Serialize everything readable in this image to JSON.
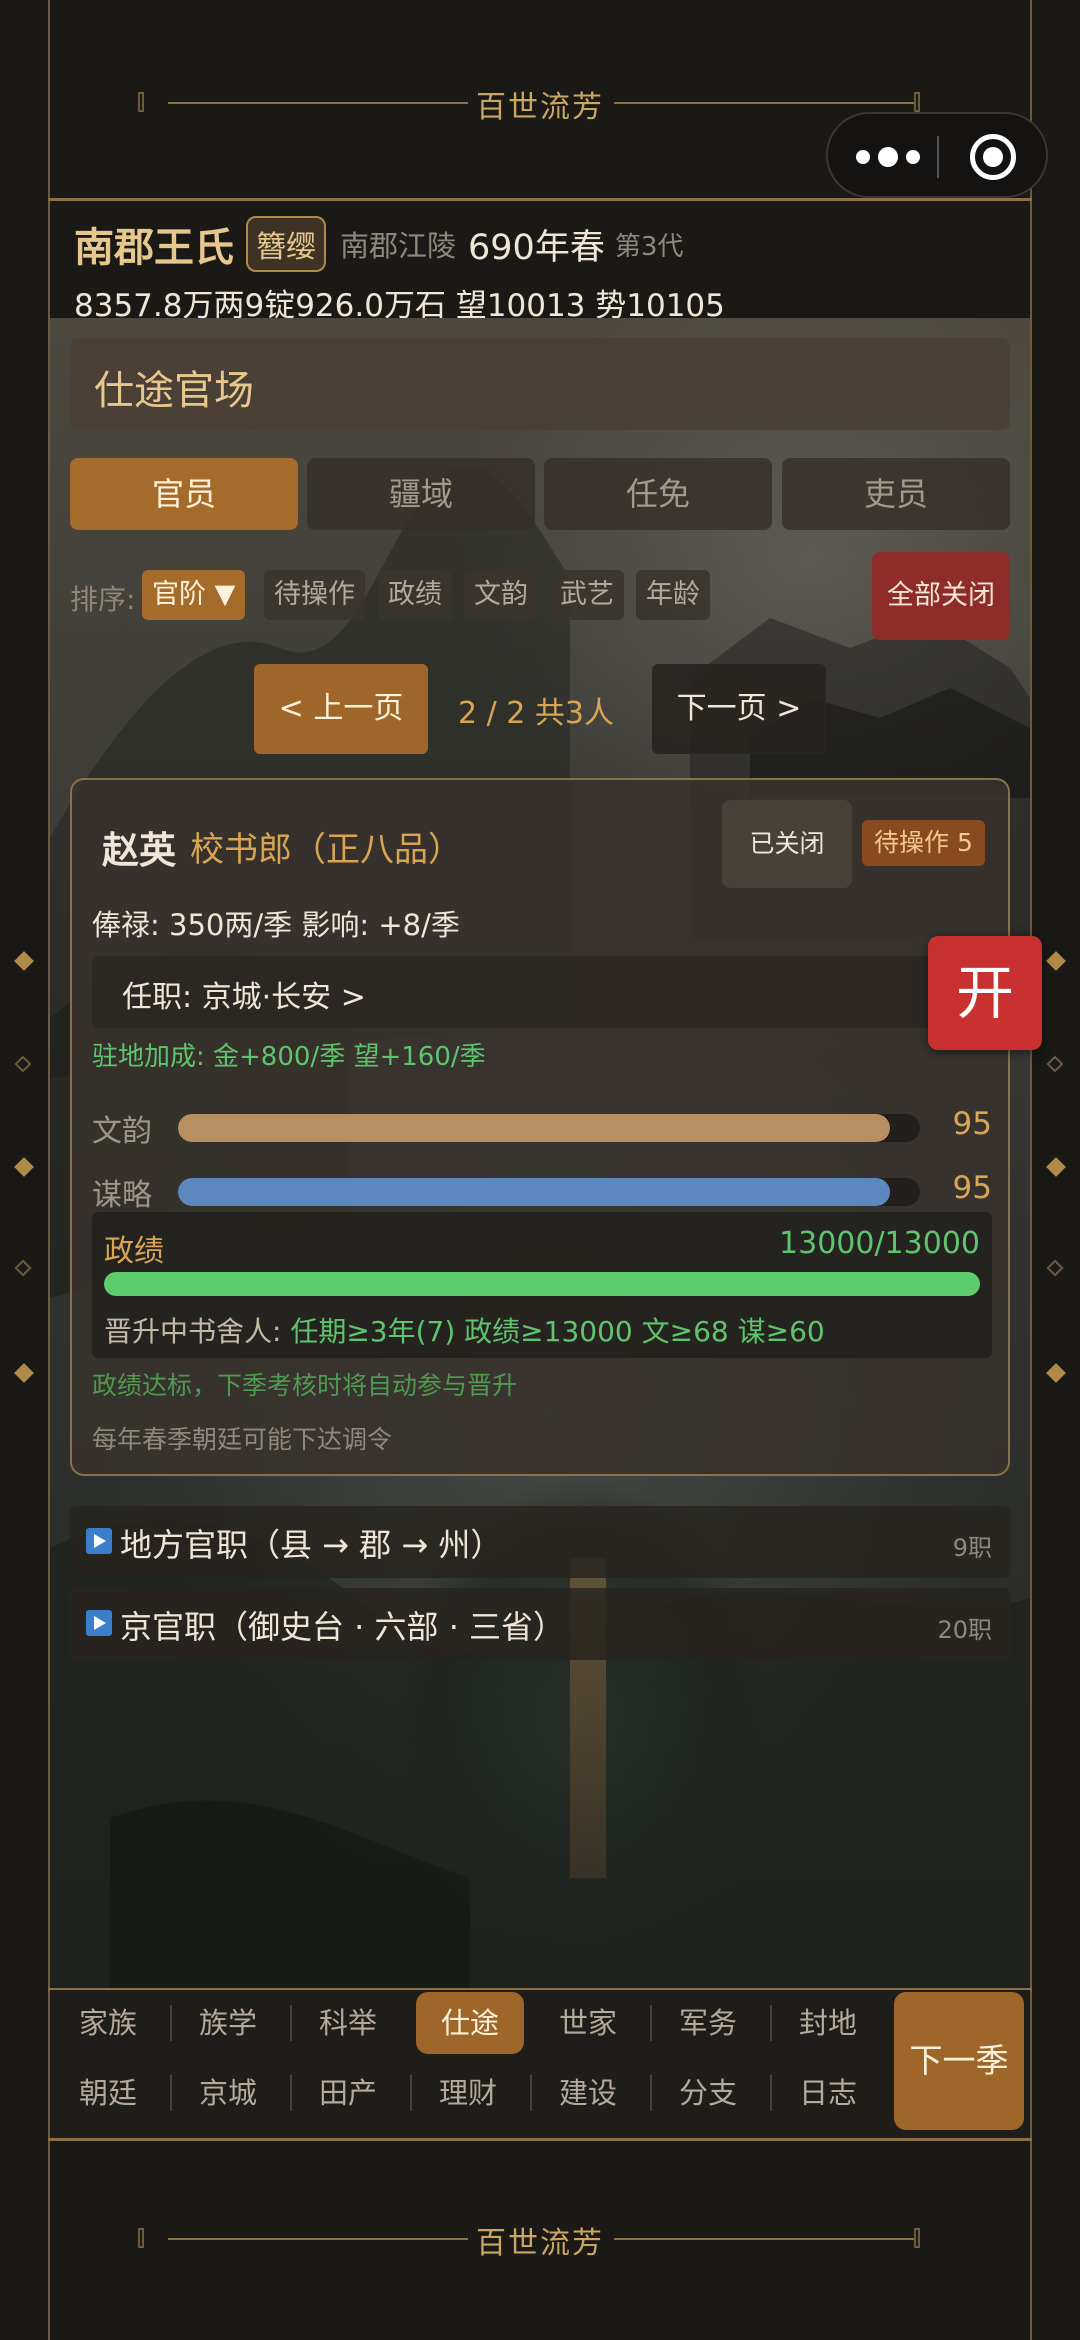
{
  "banner": {
    "title": "百世流芳"
  },
  "clan": {
    "name": "南郡王氏",
    "badge": "簪缨",
    "place": "南郡江陵",
    "year": "690年春",
    "generation": "第3代",
    "resources": "8357.8万两9锭926.0万石  望10013 势10105"
  },
  "section": {
    "title": "仕途官场"
  },
  "tabs": [
    {
      "label": "官员",
      "active": true
    },
    {
      "label": "疆域",
      "active": false
    },
    {
      "label": "任免",
      "active": false
    },
    {
      "label": "吏员",
      "active": false
    }
  ],
  "sort": {
    "label": "排序:",
    "options": [
      "官阶 ▼",
      "待操作",
      "政绩",
      "文韵",
      "武艺",
      "年龄"
    ],
    "close_all": "全部关闭"
  },
  "pager": {
    "prev": "< 上一页",
    "info": "2 / 2  共3人",
    "next": "下一页 >"
  },
  "official": {
    "name": "赵英",
    "rank": "校书郎（正八品）",
    "closed_label": "已关闭",
    "pending_label": "待操作 5",
    "salary": "俸禄: 350两/季   影响: +8/季",
    "post": "任职: 京城·长安  >",
    "station_bonus": "驻地加成: 金+800/季  望+160/季",
    "stats": [
      {
        "label": "文韵",
        "value": "95",
        "ratio": 0.96,
        "color": "#b88f63"
      },
      {
        "label": "谋略",
        "value": "95",
        "ratio": 0.96,
        "color": "#5b89bf"
      }
    ],
    "merit": {
      "label": "政绩",
      "value": "13000/13000",
      "ratio": 1.0,
      "promotion_label": "晋升中书舍人:",
      "promotion_conditions": "任期≥3年(7)  政绩≥13000  文≥68  谋≥60"
    },
    "achieved_note": "政绩达标，下季考核时将自动参与晋升",
    "edict_note": "每年春季朝廷可能下达调令"
  },
  "open_button": "开",
  "categories": [
    {
      "title": "地方官职（县 → 郡 → 州）",
      "count": "9职"
    },
    {
      "title": "京官职（御史台 · 六部 · 三省）",
      "count": "20职"
    }
  ],
  "nav": {
    "row1": [
      "家族",
      "族学",
      "科举",
      "仕途",
      "世家",
      "军务",
      "封地"
    ],
    "row2": [
      "朝廷",
      "京城",
      "田产",
      "理财",
      "建设",
      "分支",
      "日志"
    ],
    "active": "仕途",
    "next_season": "下一季"
  },
  "colors": {
    "accent": "#9e6628",
    "gold": "#d9a552",
    "green": "#5fc46e",
    "red": "#c8312f"
  }
}
